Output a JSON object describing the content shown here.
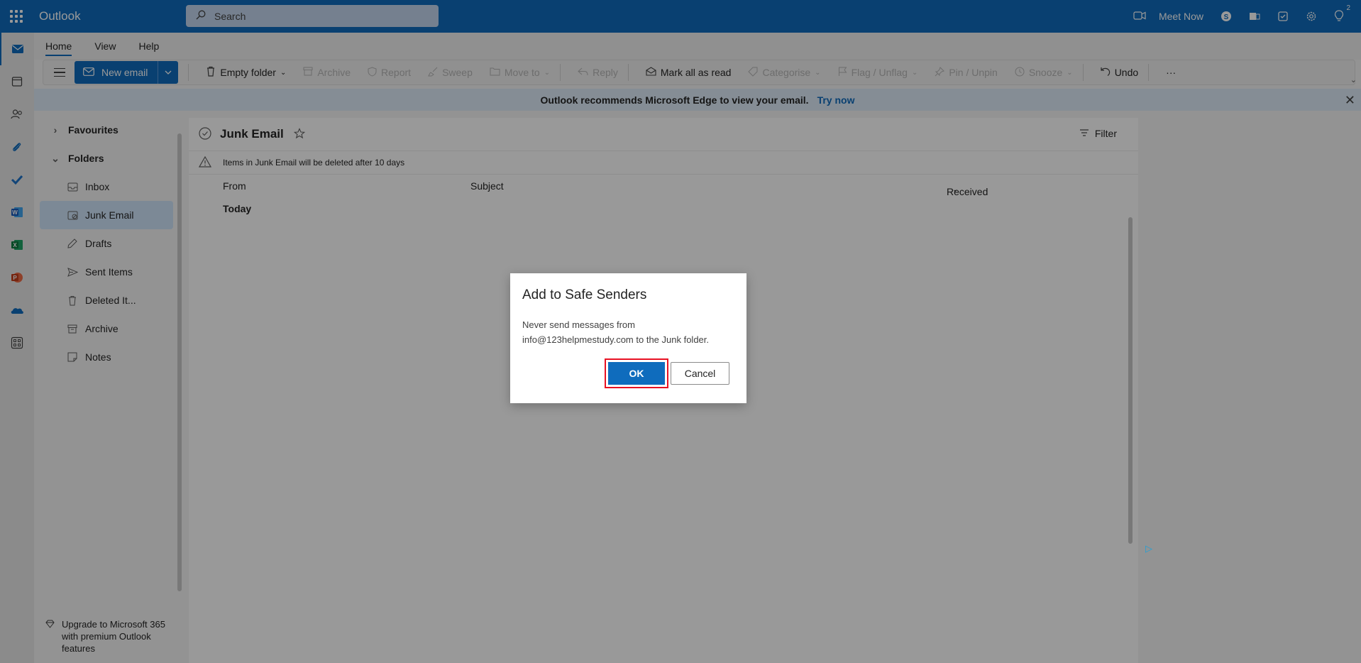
{
  "app": {
    "title": "Outlook"
  },
  "search": {
    "placeholder": "Search"
  },
  "topbar": {
    "meet_now": "Meet Now",
    "tips_badge": "2"
  },
  "ribbon_tabs": [
    "Home",
    "View",
    "Help"
  ],
  "toolbar": {
    "new_email": "New email",
    "empty_folder": "Empty folder",
    "archive": "Archive",
    "report": "Report",
    "sweep": "Sweep",
    "move_to": "Move to",
    "reply": "Reply",
    "mark_all_read": "Mark all as read",
    "categorise": "Categorise",
    "flag": "Flag / Unflag",
    "pin": "Pin / Unpin",
    "snooze": "Snooze",
    "undo": "Undo",
    "more": "···"
  },
  "banner": {
    "message": "Outlook recommends Microsoft Edge to view your email.",
    "action": "Try now"
  },
  "folders": {
    "favourites": "Favourites",
    "folders": "Folders",
    "items": [
      "Inbox",
      "Junk Email",
      "Drafts",
      "Sent Items",
      "Deleted It...",
      "Archive",
      "Notes"
    ],
    "selected": "Junk Email"
  },
  "upgrade": "Upgrade to Microsoft 365 with premium Outlook features",
  "message_list": {
    "title": "Junk Email",
    "filter": "Filter",
    "notice": "Items in Junk Email will be deleted after 10 days",
    "columns": {
      "from": "From",
      "subject": "Subject",
      "received": "Received"
    },
    "group": "Today"
  },
  "dialog": {
    "title": "Add to Safe Senders",
    "body_line1": "Never send messages from",
    "body_line2": "info@123helpmestudy.com to the Junk folder.",
    "ok": "OK",
    "cancel": "Cancel"
  },
  "colors": {
    "brand": "#0f6cbd",
    "highlight": "#e81123"
  }
}
